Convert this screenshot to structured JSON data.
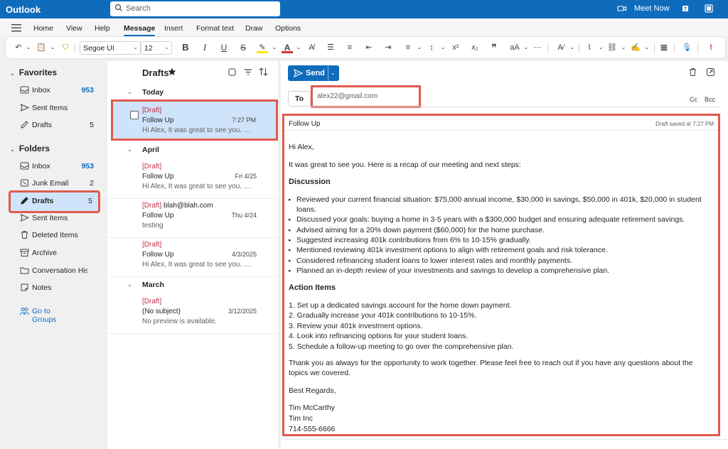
{
  "topbar": {
    "app_title": "Outlook",
    "search_placeholder": "Search",
    "meet_now": "Meet Now"
  },
  "ribbon": {
    "tabs": [
      "Home",
      "View",
      "Help",
      "Message",
      "Insert",
      "Format text",
      "Draw",
      "Options"
    ],
    "active_tab": "Message",
    "font_name": "Segoe UI",
    "font_size": "12"
  },
  "nav": {
    "favorites_label": "Favorites",
    "favorites": [
      {
        "label": "Inbox",
        "count": "953",
        "icon": "inbox-icon"
      },
      {
        "label": "Sent Items",
        "count": "",
        "icon": "send-icon"
      },
      {
        "label": "Drafts",
        "count": "5",
        "icon": "draft-icon"
      }
    ],
    "folders_label": "Folders",
    "folders": [
      {
        "label": "Inbox",
        "count": "953",
        "icon": "inbox-icon"
      },
      {
        "label": "Junk Email",
        "count": "2",
        "icon": "junk-icon"
      },
      {
        "label": "Drafts",
        "count": "5",
        "icon": "pencil-icon"
      },
      {
        "label": "Sent Items",
        "count": "",
        "icon": "send-icon"
      },
      {
        "label": "Deleted Items",
        "count": "",
        "icon": "trash-icon"
      },
      {
        "label": "Archive",
        "count": "",
        "icon": "archive-icon"
      },
      {
        "label": "Conversation Histo...",
        "count": "",
        "icon": "folder-icon"
      },
      {
        "label": "Notes",
        "count": "",
        "icon": "note-icon"
      }
    ],
    "go_to_groups": "Go to Groups"
  },
  "list": {
    "title": "Drafts",
    "groups": {
      "today": "Today",
      "april": "April",
      "march": "March"
    },
    "messages": [
      {
        "tag": "[Draft]",
        "recipient": "",
        "subject": "Follow Up",
        "time": "7:27 PM",
        "preview": "Hi Alex, It was great to see you. Her..."
      },
      {
        "tag": "[Draft]",
        "recipient": "",
        "subject": "Follow Up",
        "time": "Fri 4/25",
        "preview": "Hi Alex, It was great to see you. Her..."
      },
      {
        "tag": "[Draft]",
        "recipient": " blah@blah.com",
        "subject": "Follow Up",
        "time": "Thu 4/24",
        "preview": "testing"
      },
      {
        "tag": "[Draft]",
        "recipient": "",
        "subject": "Follow Up",
        "time": "4/3/2025",
        "preview": "Hi Alex, It was great to see you. Her..."
      },
      {
        "tag": "[Draft]",
        "recipient": "",
        "subject": "(No subject)",
        "time": "3/12/2025",
        "preview": "No preview is available."
      }
    ]
  },
  "compose": {
    "send_label": "Send",
    "to_label": "To",
    "to_value": "alex22@gmail.com",
    "cc": "Cc",
    "bcc": "Bcc",
    "subject": "Follow Up",
    "saved_status": "Draft saved at 7:27 PM",
    "greeting": "Hi Alex,",
    "intro": "It was great to see you. Here is a recap of our meeting and next steps:",
    "discussion_heading": "Discussion",
    "discussion": [
      "Reviewed your current financial situation: $75,000 annual income, $30,000 in savings, $50,000 in 401k, $20,000 in student",
      "loans.",
      "Discussed your goals: buying a home in 3-5 years with a $300,000 budget and ensuring adequate retirement savings.",
      "Advised aiming for a 20% down payment ($60,000) for the home purchase.",
      "Suggested increasing 401k contributions from 6% to 10-15% gradually.",
      "Mentioned reviewing 401k investment options to align with retirement goals and risk tolerance.",
      "Considered refinancing student loans to lower interest rates and monthly payments.",
      "Planned an in-depth review of your investments and savings to develop a comprehensive plan."
    ],
    "action_heading": "Action Items",
    "actions": [
      "1. Set up a dedicated savings account for the home down payment.",
      "2. Gradually increase your 401k contributions to 10-15%.",
      "3. Review your 401k investment options.",
      "4. Look into refinancing options for your student loans.",
      "5. Schedule a follow-up meeting to go over the comprehensive plan."
    ],
    "closing_1": "Thank you as always for the opportunity to work together. Please feel free to reach out if you have any questions about the",
    "closing_2": "topics we covered.",
    "signoff": "Best Regards,",
    "sig_name": "Tim McCarthy",
    "sig_company": "Tim Inc",
    "sig_phone": "714-555-6666"
  },
  "colors": {
    "brand_blue": "#0f6cbd",
    "highlight_red": "#e05a4d",
    "selected_bg": "#cfe4fa",
    "draft_red": "#c4314b"
  }
}
